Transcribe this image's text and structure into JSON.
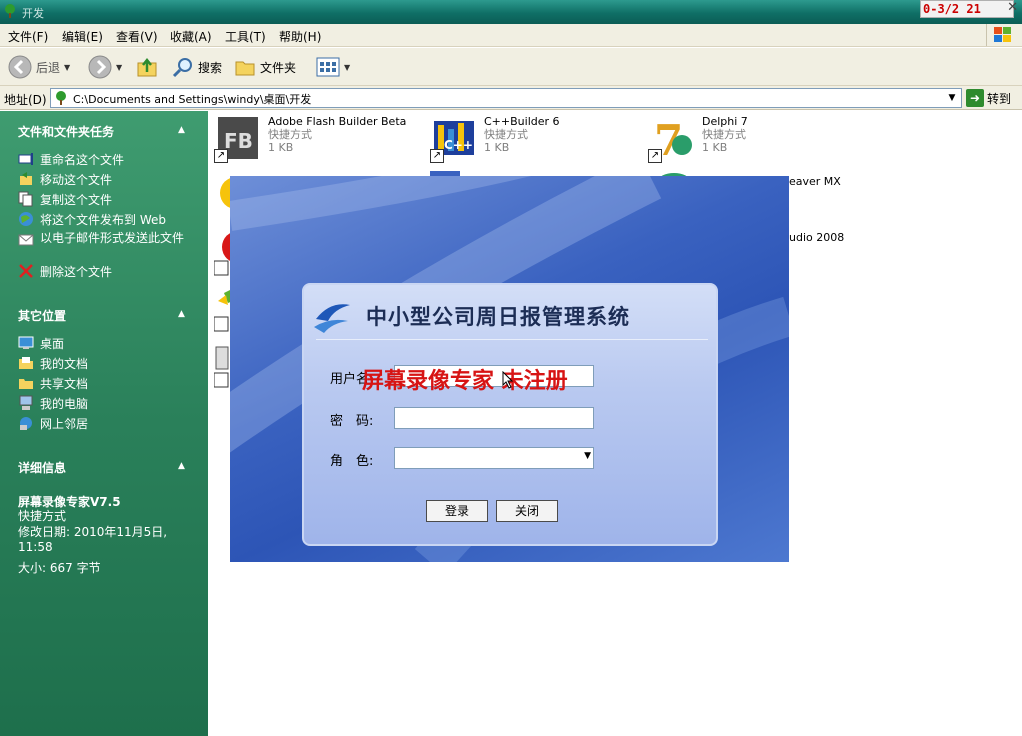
{
  "window": {
    "title": "开发",
    "overlay_text": "0-3/2 21"
  },
  "menu": [
    "文件(F)",
    "编辑(E)",
    "查看(V)",
    "收藏(A)",
    "工具(T)",
    "帮助(H)"
  ],
  "toolbar": {
    "back_label": "后退",
    "search_label": "搜索",
    "folders_label": "文件夹"
  },
  "address": {
    "label": "地址(D)",
    "path": "C:\\Documents and Settings\\windy\\桌面\\开发",
    "go_label": "转到"
  },
  "taskpane": {
    "file_tasks": {
      "header": "文件和文件夹任务",
      "items": [
        "重命名这个文件",
        "移动这个文件",
        "复制这个文件",
        "将这个文件发布到 Web",
        "以电子邮件形式发送此文件",
        "删除这个文件"
      ]
    },
    "other_places": {
      "header": "其它位置",
      "items": [
        "桌面",
        "我的文档",
        "共享文档",
        "我的电脑",
        "网上邻居"
      ]
    },
    "details": {
      "header": "详细信息",
      "name": "屏幕录像专家V7.5",
      "type": "快捷方式",
      "modified": "修改日期: 2010年11月5日, 11:58",
      "size": "大小: 667 字节"
    }
  },
  "files": [
    {
      "name": "Adobe Flash Builder Beta",
      "type": "快捷方式",
      "size": "1 KB",
      "icon": "flash-builder-icon"
    },
    {
      "name": "C++Builder 6",
      "type": "快捷方式",
      "size": "1 KB",
      "icon": "cpp-builder-icon"
    },
    {
      "name": "Delphi 7",
      "type": "快捷方式",
      "size": "1 KB",
      "icon": "delphi-icon"
    },
    {
      "name": "eaver MX",
      "icon": "dreamweaver-icon"
    },
    {
      "name": "udio 2008",
      "icon": "visual-studio-icon"
    }
  ],
  "login": {
    "title": "中小型公司周日报管理系统",
    "username_label": "用户名",
    "password_label": "密　码:",
    "role_label": "角　色:",
    "login_button": "登录",
    "close_button": "关闭",
    "watermark": "屏幕录像专家  未注册"
  },
  "colors": {
    "taskpane": "#2a805a",
    "titlebar": "#0f6f66",
    "login_bg": "#3a62c0",
    "watermark": "#d71414"
  }
}
